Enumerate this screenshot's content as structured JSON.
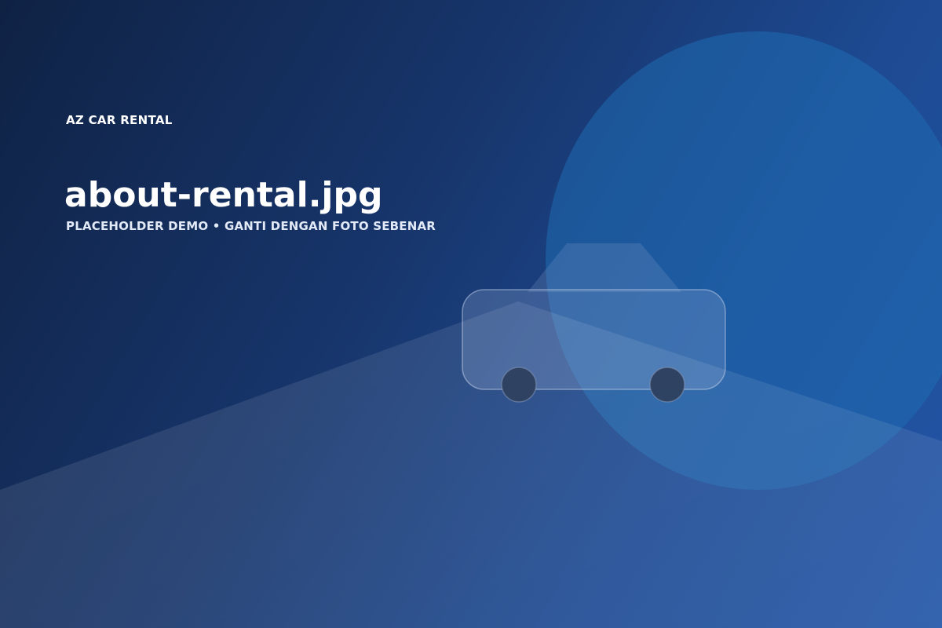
{
  "brand": "AZ CAR RENTAL",
  "title": "about-rental.jpg",
  "subtitle": "PLACEHOLDER DEMO • GANTI DENGAN FOTO SEBENAR",
  "illustration": {
    "icon": "car-icon",
    "colors": {
      "bg_dark": "#0f2244",
      "bg_light": "#2f63b5",
      "circle": "#1e68b0",
      "car_body": "#9fb4d6",
      "wheel": "#1a2f52"
    }
  }
}
